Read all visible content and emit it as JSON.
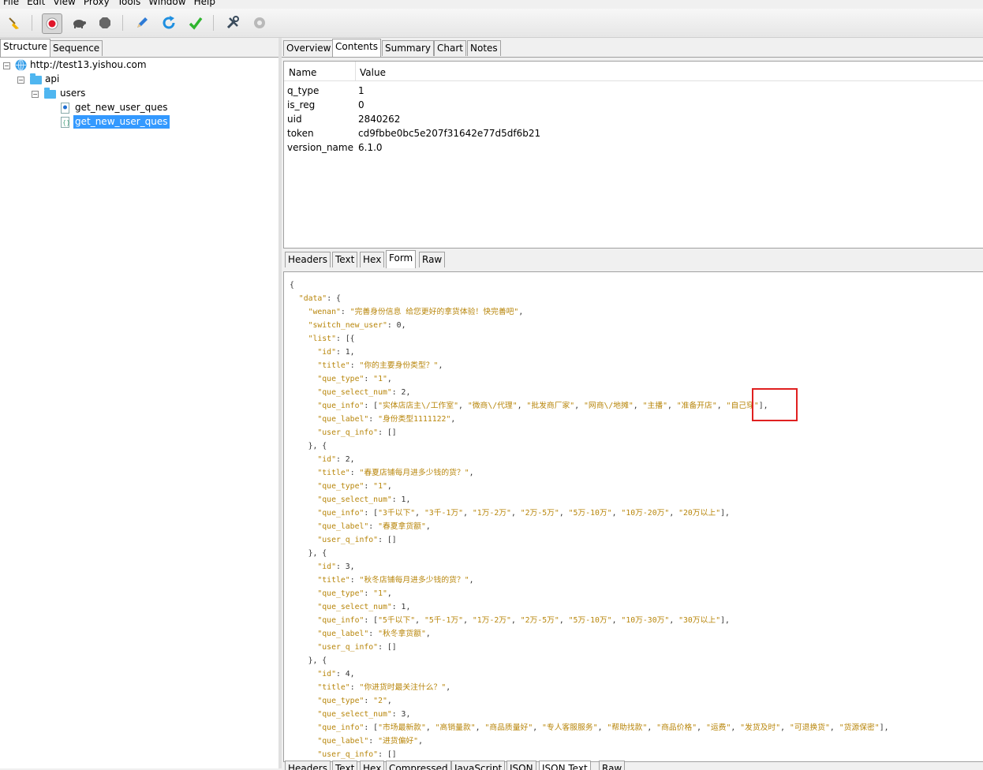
{
  "menu": [
    "File",
    "Edit",
    "View",
    "Proxy",
    "Tools",
    "Window",
    "Help"
  ],
  "toolbar": {
    "icons": [
      "broom-icon",
      "record-icon",
      "turtle-icon",
      "stop-icon",
      "pen-icon",
      "refresh-icon",
      "check-icon",
      "tools-icon",
      "settings-icon"
    ]
  },
  "left_tabs": [
    "Structure",
    "Sequence"
  ],
  "tree": {
    "host": "http://test13.yishou.com",
    "folder1": "api",
    "folder2": "users",
    "item1": "get_new_user_ques",
    "item2": "get_new_user_ques"
  },
  "right_tabs": [
    "Overview",
    "Contents",
    "Summary",
    "Chart",
    "Notes"
  ],
  "grid": {
    "headers": [
      "Name",
      "Value"
    ],
    "rows": [
      {
        "name": "q_type",
        "value": "1"
      },
      {
        "name": "is_reg",
        "value": "0"
      },
      {
        "name": "uid",
        "value": "2840262"
      },
      {
        "name": "token",
        "value": "cd9fbbe0bc5e207f31642e77d5df6b21"
      },
      {
        "name": "version_name",
        "value": "6.1.0"
      }
    ]
  },
  "mid_tabs": [
    "Headers",
    "Text",
    "Hex",
    "Form",
    "Raw"
  ],
  "bottom_tabs": [
    "Headers",
    "Text",
    "Hex",
    "Compressed",
    "JavaScript",
    "JSON",
    "JSON Text",
    "Raw"
  ],
  "json_lines": [
    "{",
    "  \"data\": {",
    "    \"wenan\": \"完善身份信息 给您更好的拿货体验！快完善吧\",",
    "    \"switch_new_user\": 0,",
    "    \"list\": [{",
    "      \"id\": 1,",
    "      \"title\": \"你的主要身份类型？\",",
    "      \"que_type\": \"1\",",
    "      \"que_select_num\": 2,",
    "      \"que_info\": [\"实体店店主\\/工作室\", \"微商\\/代理\", \"批发商厂家\", \"网商\\/地摊\", \"主播\", \"准备开店\", \"自己穿\"],",
    "      \"que_label\": \"身份类型1111122\",",
    "      \"user_q_info\": []",
    "    }, {",
    "      \"id\": 2,",
    "      \"title\": \"春夏店铺每月进多少钱的货？\",",
    "      \"que_type\": \"1\",",
    "      \"que_select_num\": 1,",
    "      \"que_info\": [\"3千以下\", \"3千-1万\", \"1万-2万\", \"2万-5万\", \"5万-10万\", \"10万-20万\", \"20万以上\"],",
    "      \"que_label\": \"春夏拿货额\",",
    "      \"user_q_info\": []",
    "    }, {",
    "      \"id\": 3,",
    "      \"title\": \"秋冬店铺每月进多少钱的货？\",",
    "      \"que_type\": \"1\",",
    "      \"que_select_num\": 1,",
    "      \"que_info\": [\"5千以下\", \"5千-1万\", \"1万-2万\", \"2万-5万\", \"5万-10万\", \"10万-30万\", \"30万以上\"],",
    "      \"que_label\": \"秋冬拿货额\",",
    "      \"user_q_info\": []",
    "    }, {",
    "      \"id\": 4,",
    "      \"title\": \"你进货时最关注什么？\",",
    "      \"que_type\": \"2\",",
    "      \"que_select_num\": 3,",
    "      \"que_info\": [\"市场最新款\", \"高销量款\", \"商品质量好\", \"专人客服服务\", \"帮助找款\", \"商品价格\", \"运费\", \"发货及时\", \"可退换货\", \"货源保密\"],",
    "      \"que_label\": \"进货偏好\",",
    "      \"user_q_info\": []"
  ]
}
